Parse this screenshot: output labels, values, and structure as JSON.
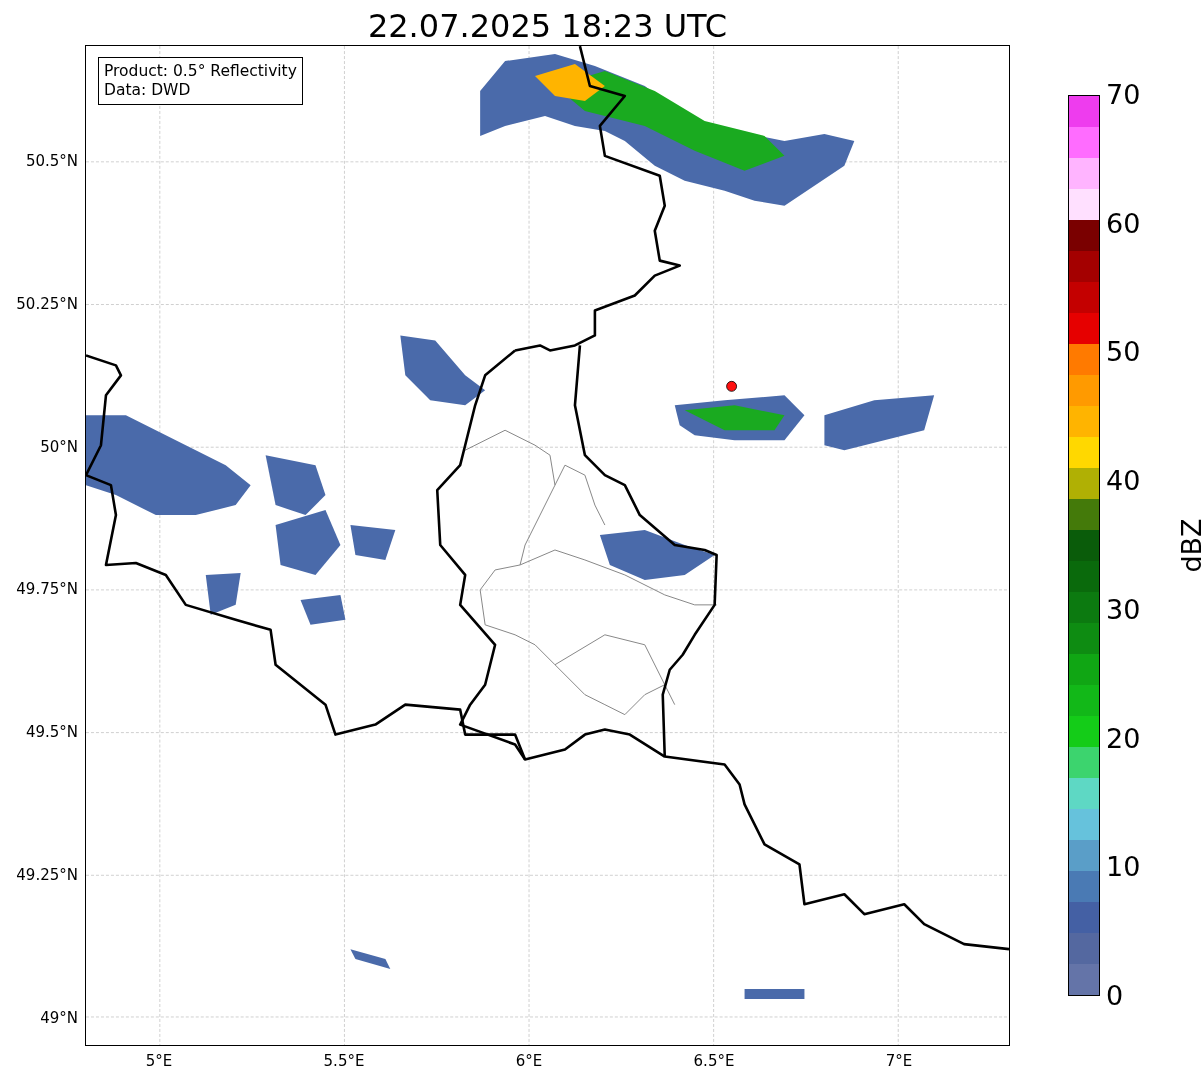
{
  "title": "22.07.2025 18:23 UTC",
  "legend_box": {
    "lines": [
      "Product: 0.5° Reflectivity",
      "Data: DWD"
    ]
  },
  "map": {
    "y_ticks": [
      "50.5°N",
      "50.25°N",
      "50°N",
      "49.75°N",
      "49.5°N",
      "49.25°N",
      "49°N"
    ],
    "x_ticks": [
      "5°E",
      "5.5°E",
      "6°E",
      "6.5°E",
      "7°E"
    ]
  },
  "colorbar": {
    "label": "dBZ",
    "ticks": [
      "70",
      "60",
      "50",
      "40",
      "30",
      "20",
      "10",
      "0"
    ],
    "bins": [
      {
        "color": "#ee3cee"
      },
      {
        "color": "#ff6cff"
      },
      {
        "color": "#ffb4ff"
      },
      {
        "color": "#ffe0ff"
      },
      {
        "color": "#7a0000"
      },
      {
        "color": "#a40000"
      },
      {
        "color": "#c40000"
      },
      {
        "color": "#e60000"
      },
      {
        "color": "#ff7a00"
      },
      {
        "color": "#ff9a00"
      },
      {
        "color": "#ffb400"
      },
      {
        "color": "#ffd800"
      },
      {
        "color": "#b0b004"
      },
      {
        "color": "#447a0a"
      },
      {
        "color": "#0a5c0a"
      },
      {
        "color": "#0a6a0c"
      },
      {
        "color": "#0c7a10"
      },
      {
        "color": "#0e8c12"
      },
      {
        "color": "#10a614"
      },
      {
        "color": "#12b818"
      },
      {
        "color": "#14cc18"
      },
      {
        "color": "#3cd46e"
      },
      {
        "color": "#5ed8c4"
      },
      {
        "color": "#66c2dc"
      },
      {
        "color": "#5a9ec8"
      },
      {
        "color": "#4a7ab4"
      },
      {
        "color": "#4460a4"
      },
      {
        "color": "#5468a0"
      },
      {
        "color": "#6474a8"
      }
    ]
  }
}
